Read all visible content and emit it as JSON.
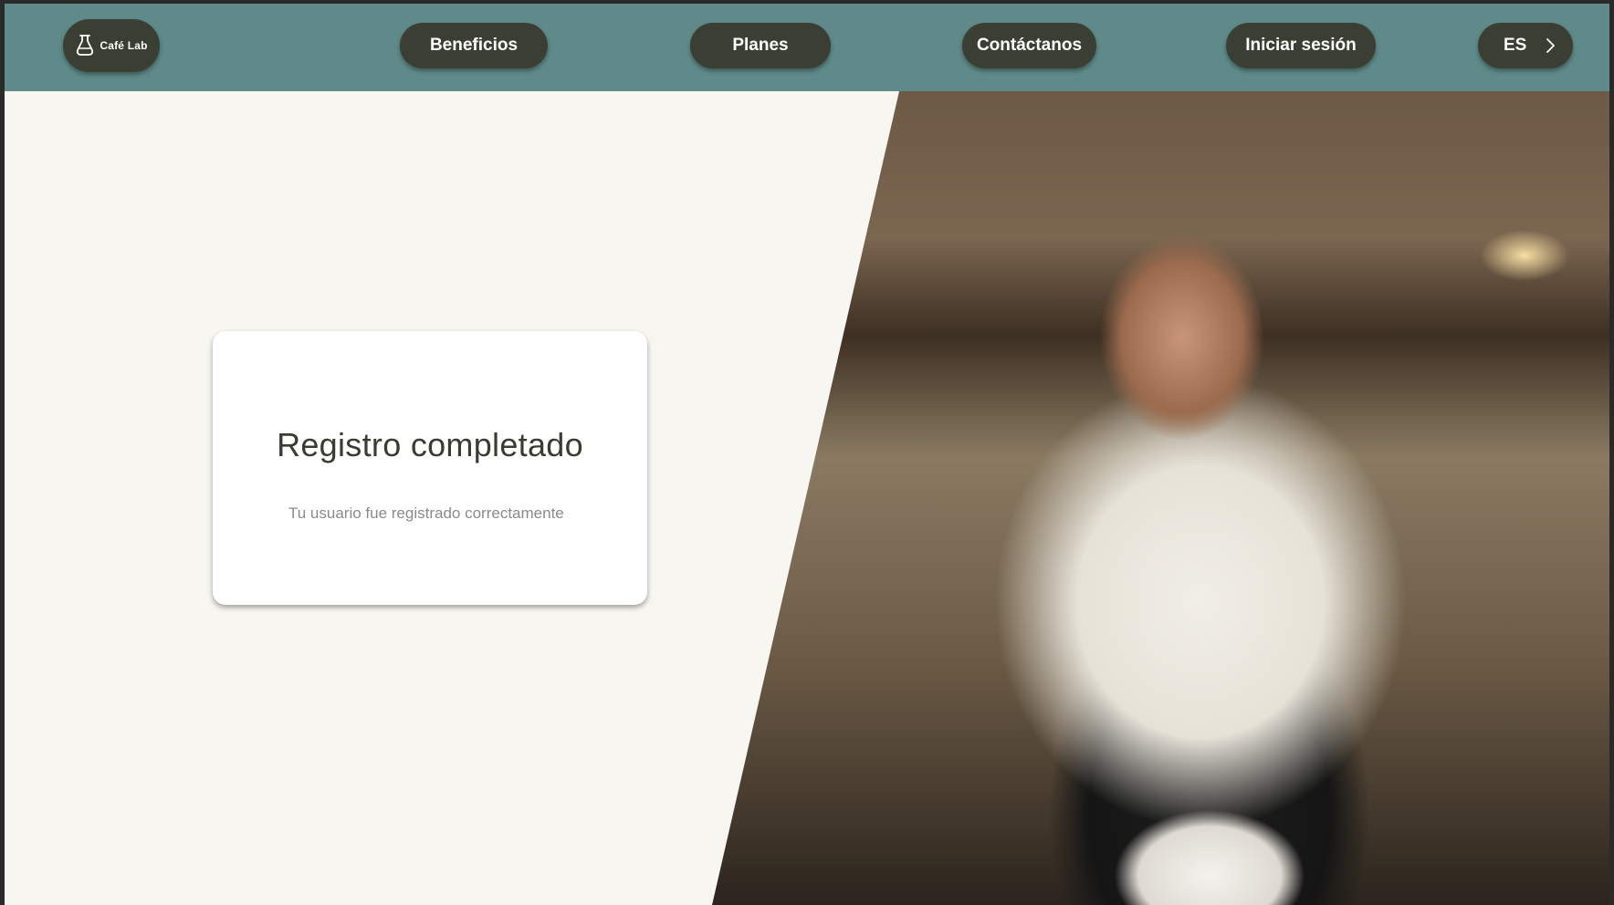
{
  "header": {
    "logo_text": "Café Lab",
    "nav": {
      "beneficios": "Beneficios",
      "planes": "Planes",
      "contactanos": "Contáctanos",
      "iniciar_sesion": "Iniciar sesión"
    },
    "language": "ES"
  },
  "card": {
    "title": "Registro completado",
    "subtitle": "Tu usuario fue registrado correctamente"
  },
  "icons": {
    "logo": "coffee-maker-icon",
    "language_arrow": "chevron-right-icon"
  },
  "colors": {
    "header_bg": "#5f8a89",
    "pill_bg": "#3b3f33",
    "page_bg": "#f8f6f1"
  }
}
